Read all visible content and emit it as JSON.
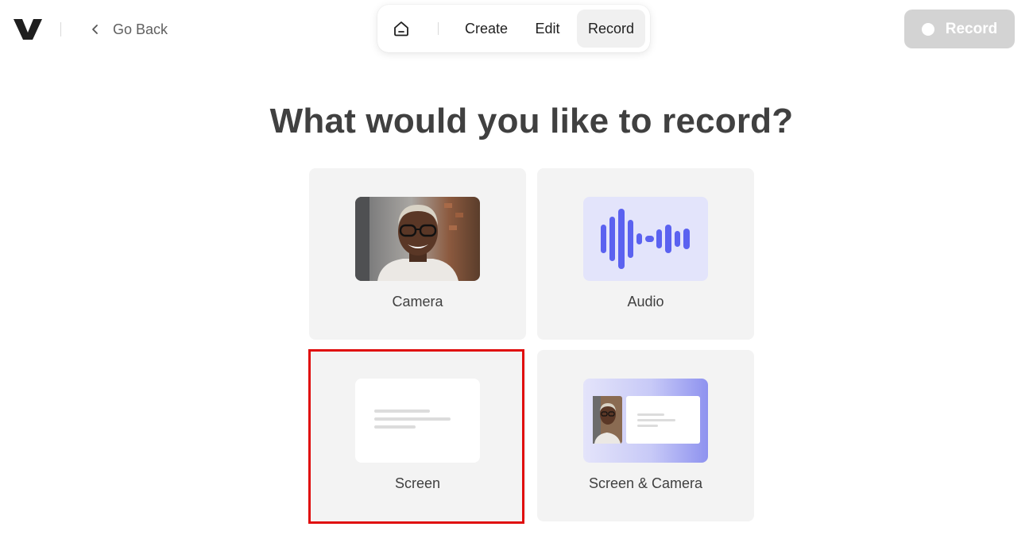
{
  "header": {
    "logo_icon": "vimeo-v-logo",
    "go_back_label": "Go Back"
  },
  "nav": {
    "home_icon": "home-icon",
    "tabs": [
      {
        "label": "Create"
      },
      {
        "label": "Edit"
      },
      {
        "label": "Record",
        "active": true
      }
    ]
  },
  "record_button": {
    "label": "Record",
    "disabled": true
  },
  "main": {
    "heading": "What would you like to record?",
    "options": [
      {
        "label": "Camera"
      },
      {
        "label": "Audio"
      },
      {
        "label": "Screen",
        "selected": true
      },
      {
        "label": "Screen & Camera"
      }
    ]
  },
  "colors": {
    "accent": "#5b62f0",
    "highlight": "#e00d0d",
    "card_bg": "#f3f3f3",
    "record_button_bg": "#d3d3d3"
  }
}
